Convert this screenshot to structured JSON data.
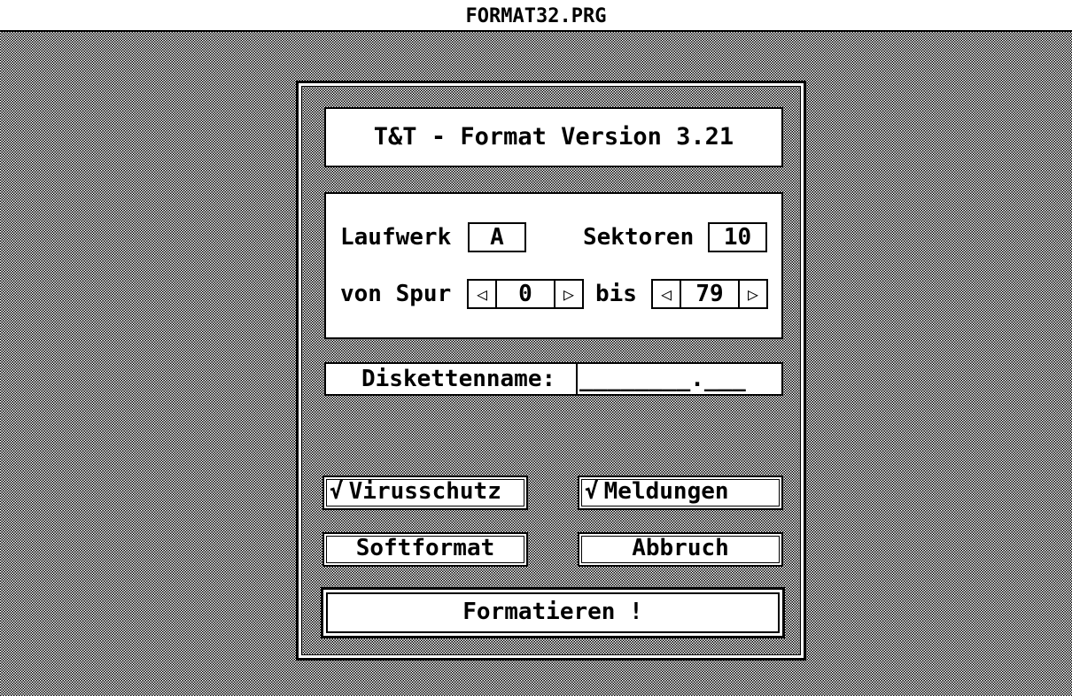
{
  "window": {
    "title": "FORMAT32.PRG"
  },
  "dialog": {
    "heading": "T&T - Format Version 3.21",
    "drive": {
      "label": "Laufwerk",
      "value": "A"
    },
    "sectors": {
      "label": "Sektoren",
      "value": "10"
    },
    "track_from": {
      "label": "von Spur",
      "value": "0",
      "dec_icon": "arrow-left-icon",
      "inc_icon": "arrow-right-icon"
    },
    "track_to": {
      "label": "bis",
      "value": "79",
      "dec_icon": "arrow-left-icon",
      "inc_icon": "arrow-right-icon"
    },
    "disk_name": {
      "label": "Diskettenname:",
      "value": "________.___"
    },
    "options": {
      "virus_protection": {
        "label": "Virusschutz",
        "checked": true,
        "check_mark": "√"
      },
      "messages": {
        "label": "Meldungen",
        "checked": true,
        "check_mark": "√"
      }
    },
    "buttons": {
      "softformat": "Softformat",
      "cancel": "Abbruch",
      "format": "Formatieren !"
    }
  },
  "colors": {
    "foreground": "#000000",
    "background": "#ffffff"
  }
}
